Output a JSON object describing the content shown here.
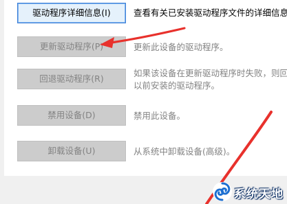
{
  "actions": [
    {
      "button_label": "驱动程序详细信息(I)",
      "button_state": "focused",
      "description": "查看有关已安装驱动程序文件的详细信息。"
    },
    {
      "button_label": "更新驱动程序(P)",
      "button_state": "disabled",
      "description": "更新此设备的驱动程序。"
    },
    {
      "button_label": "回退驱动程序(R)",
      "button_state": "disabled",
      "description_lines": [
        "如果该设备在更新驱动程序时失败，则回退到",
        "以前安装的驱动程序。"
      ]
    },
    {
      "button_label": "禁用设备(D)",
      "button_state": "disabled",
      "description": "禁用此设备。"
    },
    {
      "button_label": "卸载设备(U)",
      "button_state": "disabled",
      "description": "从系统中卸载设备(高级)。"
    }
  ],
  "annotation": {
    "arrow_color": "#e8312c",
    "arrow_target": "更新驱动程序(P)"
  },
  "watermark": {
    "text": "系统天地",
    "logo_icon": "blue-swirl-logo"
  },
  "colors": {
    "panel_background": "#ffffff",
    "window_background": "#f0f0f0",
    "disabled_text": "#838383",
    "focus_border": "#3c7fd6"
  }
}
